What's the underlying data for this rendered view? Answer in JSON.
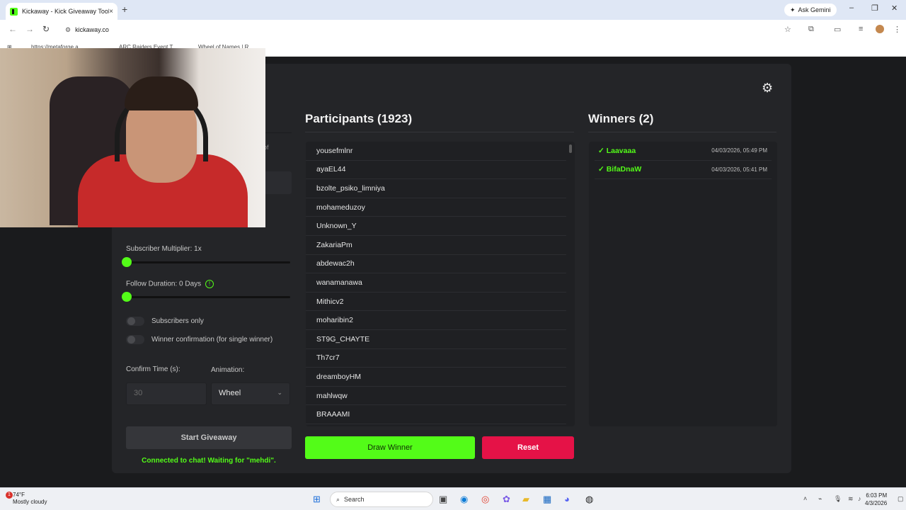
{
  "browser": {
    "tab_title": "Kickaway - Kick Giveaway Tool",
    "tab_close": "×",
    "new_tab": "+",
    "ask_gemini": "Ask Gemini",
    "url": "kickaway.co",
    "bookmarks": [
      "https://metaforge.a...",
      "ARC Raiders Event T...",
      "Wheel of Names | R..."
    ]
  },
  "settings": {
    "subscriber_multiplier_label": "Subscriber Multiplier: 1x",
    "subscriber_multiplier_value": 1,
    "follow_duration_label": "Follow Duration:  0  Days",
    "follow_duration_value": 0,
    "trailing_text": "of",
    "subscribers_only_label": "Subscribers only",
    "subscribers_only": false,
    "winner_confirmation_label": "Winner confirmation (for single winner)",
    "winner_confirmation": false,
    "confirm_time_label": "Confirm Time (s):",
    "confirm_time_value": "30",
    "animation_label": "Animation:",
    "animation_value": "Wheel",
    "start_button": "Start Giveaway",
    "status": "Connected to chat! Waiting for \"mehdi\"."
  },
  "participants": {
    "title": "Participants (1923)",
    "items": [
      "yousefmlnr",
      "ayaEL44",
      "bzolte_psiko_limniya",
      "mohameduzoy",
      "Unknown_Y",
      "ZakariaPm",
      "abdewac2h",
      "wanamanawa",
      "Mithicv2",
      "moharibin2",
      "ST9G_CHAYTE",
      "Th7cr7",
      "dreamboyHM",
      "mahlwqw",
      "BRAAAMI"
    ],
    "draw_button": "Draw Winner",
    "reset_button": "Reset"
  },
  "winners": {
    "title": "Winners (2)",
    "items": [
      {
        "name": "✓ Laavaaa",
        "date": "04/03/2026, 05:49 PM"
      },
      {
        "name": "✓ BifaDnaW",
        "date": "04/03/2026, 05:41 PM"
      }
    ]
  },
  "taskbar": {
    "temp": "74°F",
    "weather": "Mostly cloudy",
    "weather_badge": "1",
    "search": "Search",
    "time": "6:03 PM",
    "date": "4/3/2026"
  },
  "colors": {
    "accent": "#53fc18",
    "danger": "#e51247",
    "card": "#242528",
    "background": "#1a1b1d"
  }
}
